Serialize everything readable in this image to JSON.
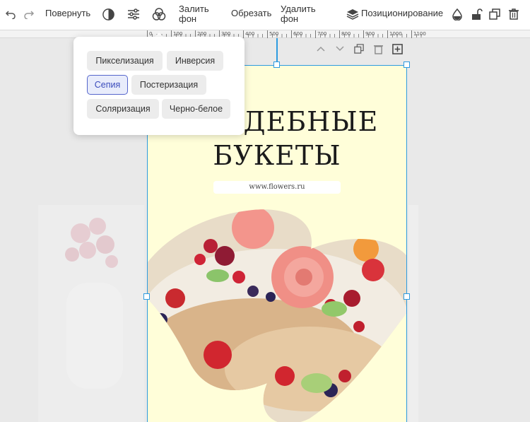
{
  "toolbar": {
    "rotate_label": "Повернуть",
    "fill_bg_line1": "Залить",
    "fill_bg_line2": "фон",
    "crop_label": "Обрезать",
    "remove_bg_line1": "Удалить",
    "remove_bg_line2": "фон",
    "positioning_label": "Позиционирование",
    "icons": [
      "undo-icon",
      "redo-icon",
      "contrast-icon",
      "sliders-icon",
      "filters-icon",
      "layers-icon",
      "drop-icon",
      "unlock-icon",
      "duplicate-icon",
      "trash-icon"
    ]
  },
  "ruler": {
    "labels": [
      "0",
      "100",
      "200",
      "300",
      "400",
      "500",
      "600",
      "700",
      "800",
      "900",
      "1000",
      "1100"
    ]
  },
  "filters": {
    "chips": [
      "Пикселизация",
      "Инверсия",
      "Сепия",
      "Постеризация",
      "Соляризация",
      "Черно-белое"
    ],
    "selected": "Сепия"
  },
  "card": {
    "title_line1": "ДЕБНЫЕ",
    "title_line2": "БУКЕТЫ",
    "url": "www.flowers.ru",
    "background": "#fffed9"
  },
  "colors": {
    "accent": "#2d9be0",
    "chip_active_border": "#5566cc"
  }
}
